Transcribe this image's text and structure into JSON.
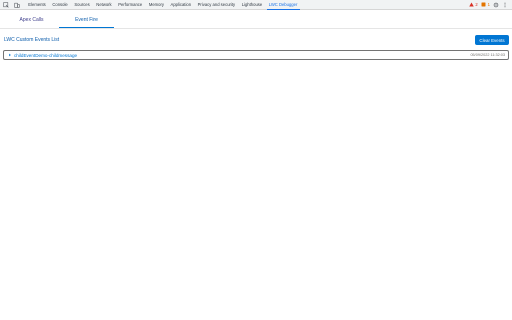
{
  "devtools": {
    "tabs": [
      {
        "label": "Elements"
      },
      {
        "label": "Console"
      },
      {
        "label": "Sources"
      },
      {
        "label": "Network"
      },
      {
        "label": "Performance"
      },
      {
        "label": "Memory"
      },
      {
        "label": "Application"
      },
      {
        "label": "Privacy and security"
      },
      {
        "label": "Lighthouse"
      },
      {
        "label": "LWC Debugger"
      }
    ],
    "active_tab": "LWC Debugger",
    "warnings": "2",
    "errors": "1",
    "icons": [
      "inspect-element-icon",
      "device-toggle-icon",
      "warning-icon",
      "error-icon",
      "settings-icon",
      "more-options-icon"
    ]
  },
  "panel": {
    "tabs": [
      {
        "label": "Apex Calls"
      },
      {
        "label": "Event Fire"
      }
    ],
    "active_tab": "Event Fire",
    "list_title": "LWC Custom Events List",
    "clear_label": "Clear Events",
    "events": [
      {
        "name": "childEventDemo-childmessage",
        "time": "05/09/2022 11:32:03"
      }
    ]
  },
  "colors": {
    "accent": "#0176d3",
    "active_devtools": "#1a73e8",
    "warning": "#d93025",
    "error": "#e37400"
  }
}
